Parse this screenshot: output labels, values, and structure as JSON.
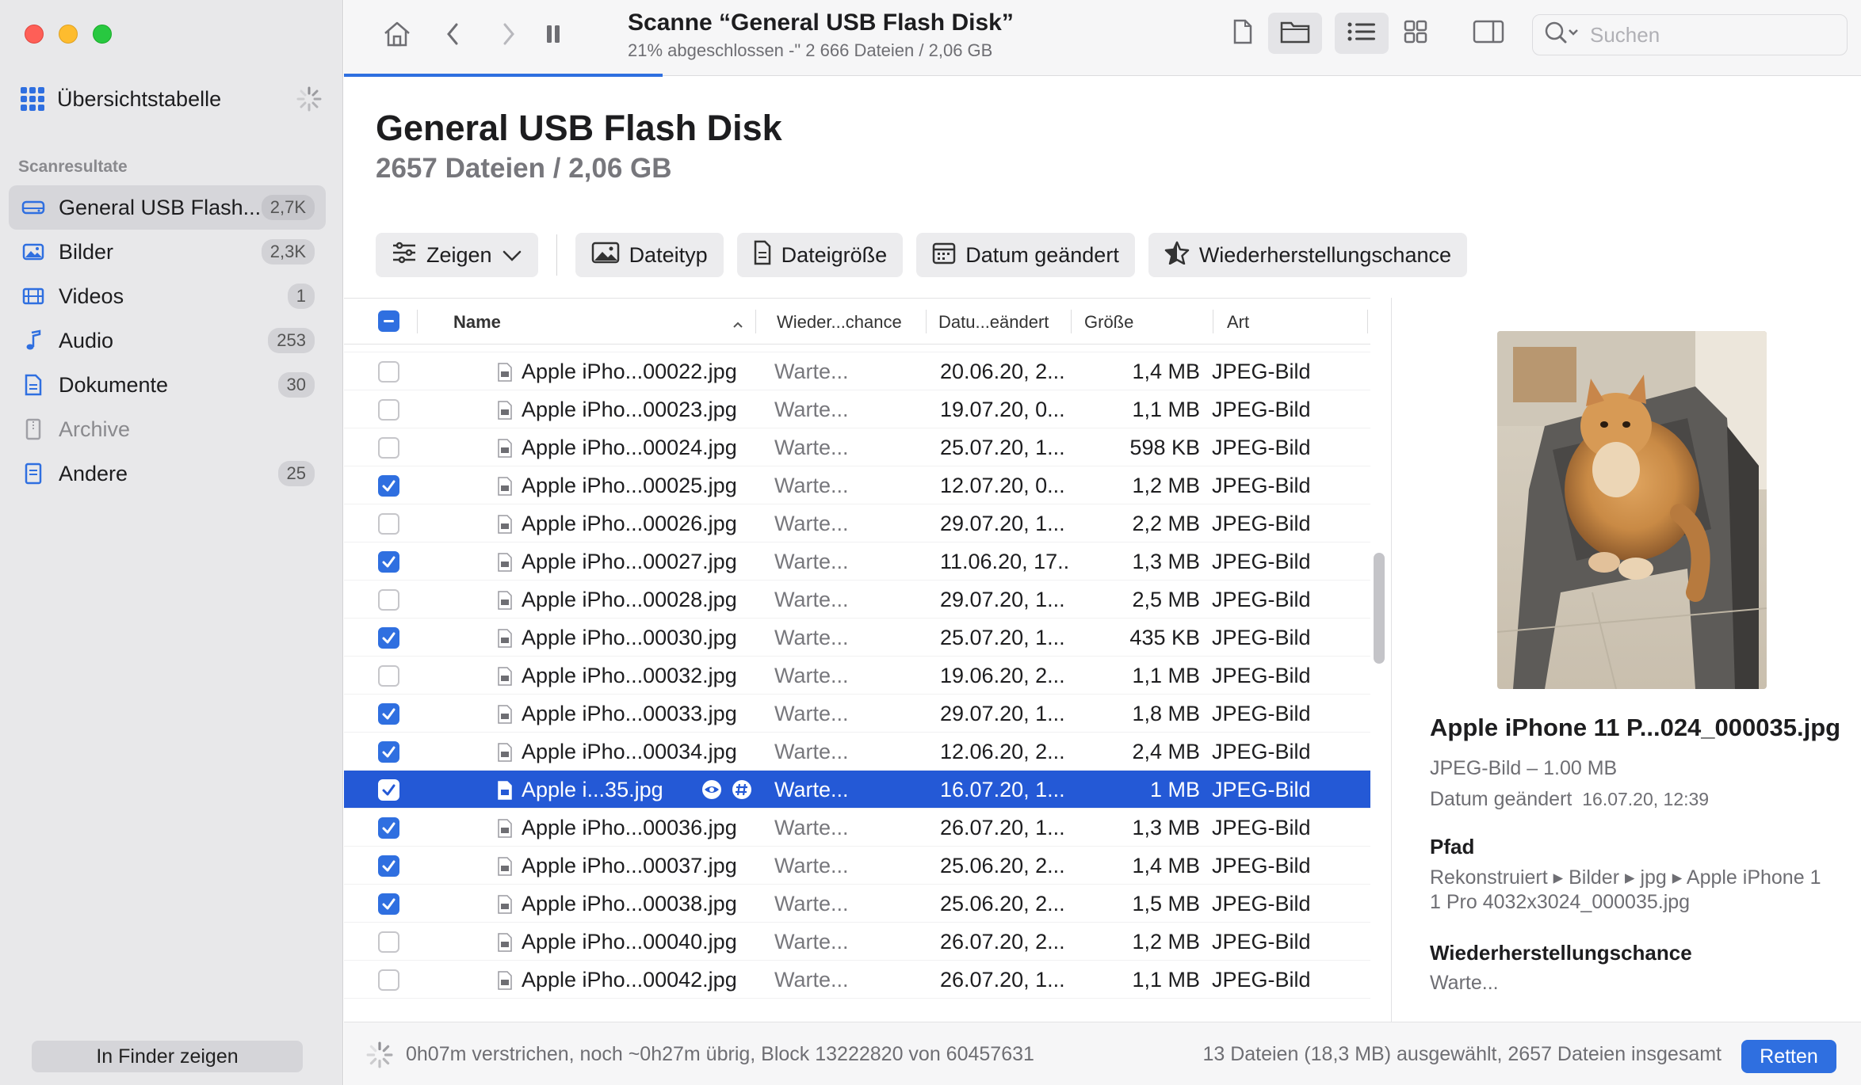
{
  "sidebar": {
    "overview_label": "Übersichtstabelle",
    "section_label": "Scanresultate",
    "items": [
      {
        "label": "General USB Flash...",
        "badge": "2,7K",
        "icon": "drive-icon"
      },
      {
        "label": "Bilder",
        "badge": "2,3K",
        "icon": "photo-icon"
      },
      {
        "label": "Videos",
        "badge": "1",
        "icon": "film-icon"
      },
      {
        "label": "Audio",
        "badge": "253",
        "icon": "music-note-icon"
      },
      {
        "label": "Dokumente",
        "badge": "30",
        "icon": "document-icon"
      },
      {
        "label": "Archive",
        "badge": "",
        "icon": "archive-icon"
      },
      {
        "label": "Andere",
        "badge": "25",
        "icon": "other-file-icon"
      }
    ],
    "finder_button": "In Finder zeigen"
  },
  "toolbar": {
    "title": "Scanne “General USB Flash Disk”",
    "subtitle": "21% abgeschlossen -\" 2 666 Dateien / 2,06 GB",
    "progress": 0.21,
    "search_placeholder": "Suchen"
  },
  "header": {
    "title": "General USB Flash Disk",
    "subtitle": "2657 Dateien / 2,06 GB"
  },
  "filters": {
    "show": "Zeigen",
    "filetype": "Dateityp",
    "filesize": "Dateigröße",
    "date": "Datum geändert",
    "chance": "Wiederherstellungschance"
  },
  "table": {
    "columns": {
      "name": "Name",
      "chance": "Wieder...chance",
      "date": "Datu...eändert",
      "size": "Größe",
      "kind": "Art"
    },
    "rows": [
      {
        "name": "Apple iPho...00022.jpg",
        "chance": "Warte...",
        "date": "20.06.20, 2...",
        "size": "1,4 MB",
        "kind": "JPEG-Bild",
        "checked": false
      },
      {
        "name": "Apple iPho...00023.jpg",
        "chance": "Warte...",
        "date": "19.07.20, 0...",
        "size": "1,1 MB",
        "kind": "JPEG-Bild",
        "checked": false
      },
      {
        "name": "Apple iPho...00024.jpg",
        "chance": "Warte...",
        "date": "25.07.20, 1...",
        "size": "598 KB",
        "kind": "JPEG-Bild",
        "checked": false
      },
      {
        "name": "Apple iPho...00025.jpg",
        "chance": "Warte...",
        "date": "12.07.20, 0...",
        "size": "1,2 MB",
        "kind": "JPEG-Bild",
        "checked": true
      },
      {
        "name": "Apple iPho...00026.jpg",
        "chance": "Warte...",
        "date": "29.07.20, 1...",
        "size": "2,2 MB",
        "kind": "JPEG-Bild",
        "checked": false
      },
      {
        "name": "Apple iPho...00027.jpg",
        "chance": "Warte...",
        "date": "11.06.20, 17...",
        "size": "1,3 MB",
        "kind": "JPEG-Bild",
        "checked": true
      },
      {
        "name": "Apple iPho...00028.jpg",
        "chance": "Warte...",
        "date": "29.07.20, 1...",
        "size": "2,5 MB",
        "kind": "JPEG-Bild",
        "checked": false
      },
      {
        "name": "Apple iPho...00030.jpg",
        "chance": "Warte...",
        "date": "25.07.20, 1...",
        "size": "435 KB",
        "kind": "JPEG-Bild",
        "checked": true
      },
      {
        "name": "Apple iPho...00032.jpg",
        "chance": "Warte...",
        "date": "19.06.20, 2...",
        "size": "1,1 MB",
        "kind": "JPEG-Bild",
        "checked": false
      },
      {
        "name": "Apple iPho...00033.jpg",
        "chance": "Warte...",
        "date": "29.07.20, 1...",
        "size": "1,8 MB",
        "kind": "JPEG-Bild",
        "checked": true
      },
      {
        "name": "Apple iPho...00034.jpg",
        "chance": "Warte...",
        "date": "12.06.20, 2...",
        "size": "2,4 MB",
        "kind": "JPEG-Bild",
        "checked": true
      },
      {
        "name": "Apple i...35.jpg",
        "chance": "Warte...",
        "date": "16.07.20, 1...",
        "size": "1 MB",
        "kind": "JPEG-Bild",
        "checked": true,
        "selected": true
      },
      {
        "name": "Apple iPho...00036.jpg",
        "chance": "Warte...",
        "date": "26.07.20, 1...",
        "size": "1,3 MB",
        "kind": "JPEG-Bild",
        "checked": true
      },
      {
        "name": "Apple iPho...00037.jpg",
        "chance": "Warte...",
        "date": "25.06.20, 2...",
        "size": "1,4 MB",
        "kind": "JPEG-Bild",
        "checked": true
      },
      {
        "name": "Apple iPho...00038.jpg",
        "chance": "Warte...",
        "date": "25.06.20, 2...",
        "size": "1,5 MB",
        "kind": "JPEG-Bild",
        "checked": true
      },
      {
        "name": "Apple iPho...00040.jpg",
        "chance": "Warte...",
        "date": "26.07.20, 2...",
        "size": "1,2 MB",
        "kind": "JPEG-Bild",
        "checked": false
      },
      {
        "name": "Apple iPho...00042.jpg",
        "chance": "Warte...",
        "date": "26.07.20, 1...",
        "size": "1,1 MB",
        "kind": "JPEG-Bild",
        "checked": false
      }
    ]
  },
  "details": {
    "title": "Apple iPhone 11 P...024_000035.jpg",
    "kind_size": "JPEG-Bild – 1.00 MB",
    "date_label": "Datum geändert",
    "date_value": "16.07.20, 12:39",
    "path_heading": "Pfad",
    "path_line1": "Rekonstruiert ▸ Bilder ▸ jpg ▸ Apple iPhone 1",
    "path_line2": "1 Pro 4032x3024_000035.jpg",
    "chance_heading": "Wiederherstellungschance",
    "chance_value": "Warte..."
  },
  "bottom": {
    "status": "0h07m verstrichen, noch ~0h27m übrig, Block 13222820 von 60457631",
    "selection": "13 Dateien (18,3 MB) ausgewählt, 2657 Dateien insgesamt",
    "recover_button": "Retten"
  },
  "colors": {
    "accent": "#2f6fe0",
    "selection": "#2459d6"
  }
}
